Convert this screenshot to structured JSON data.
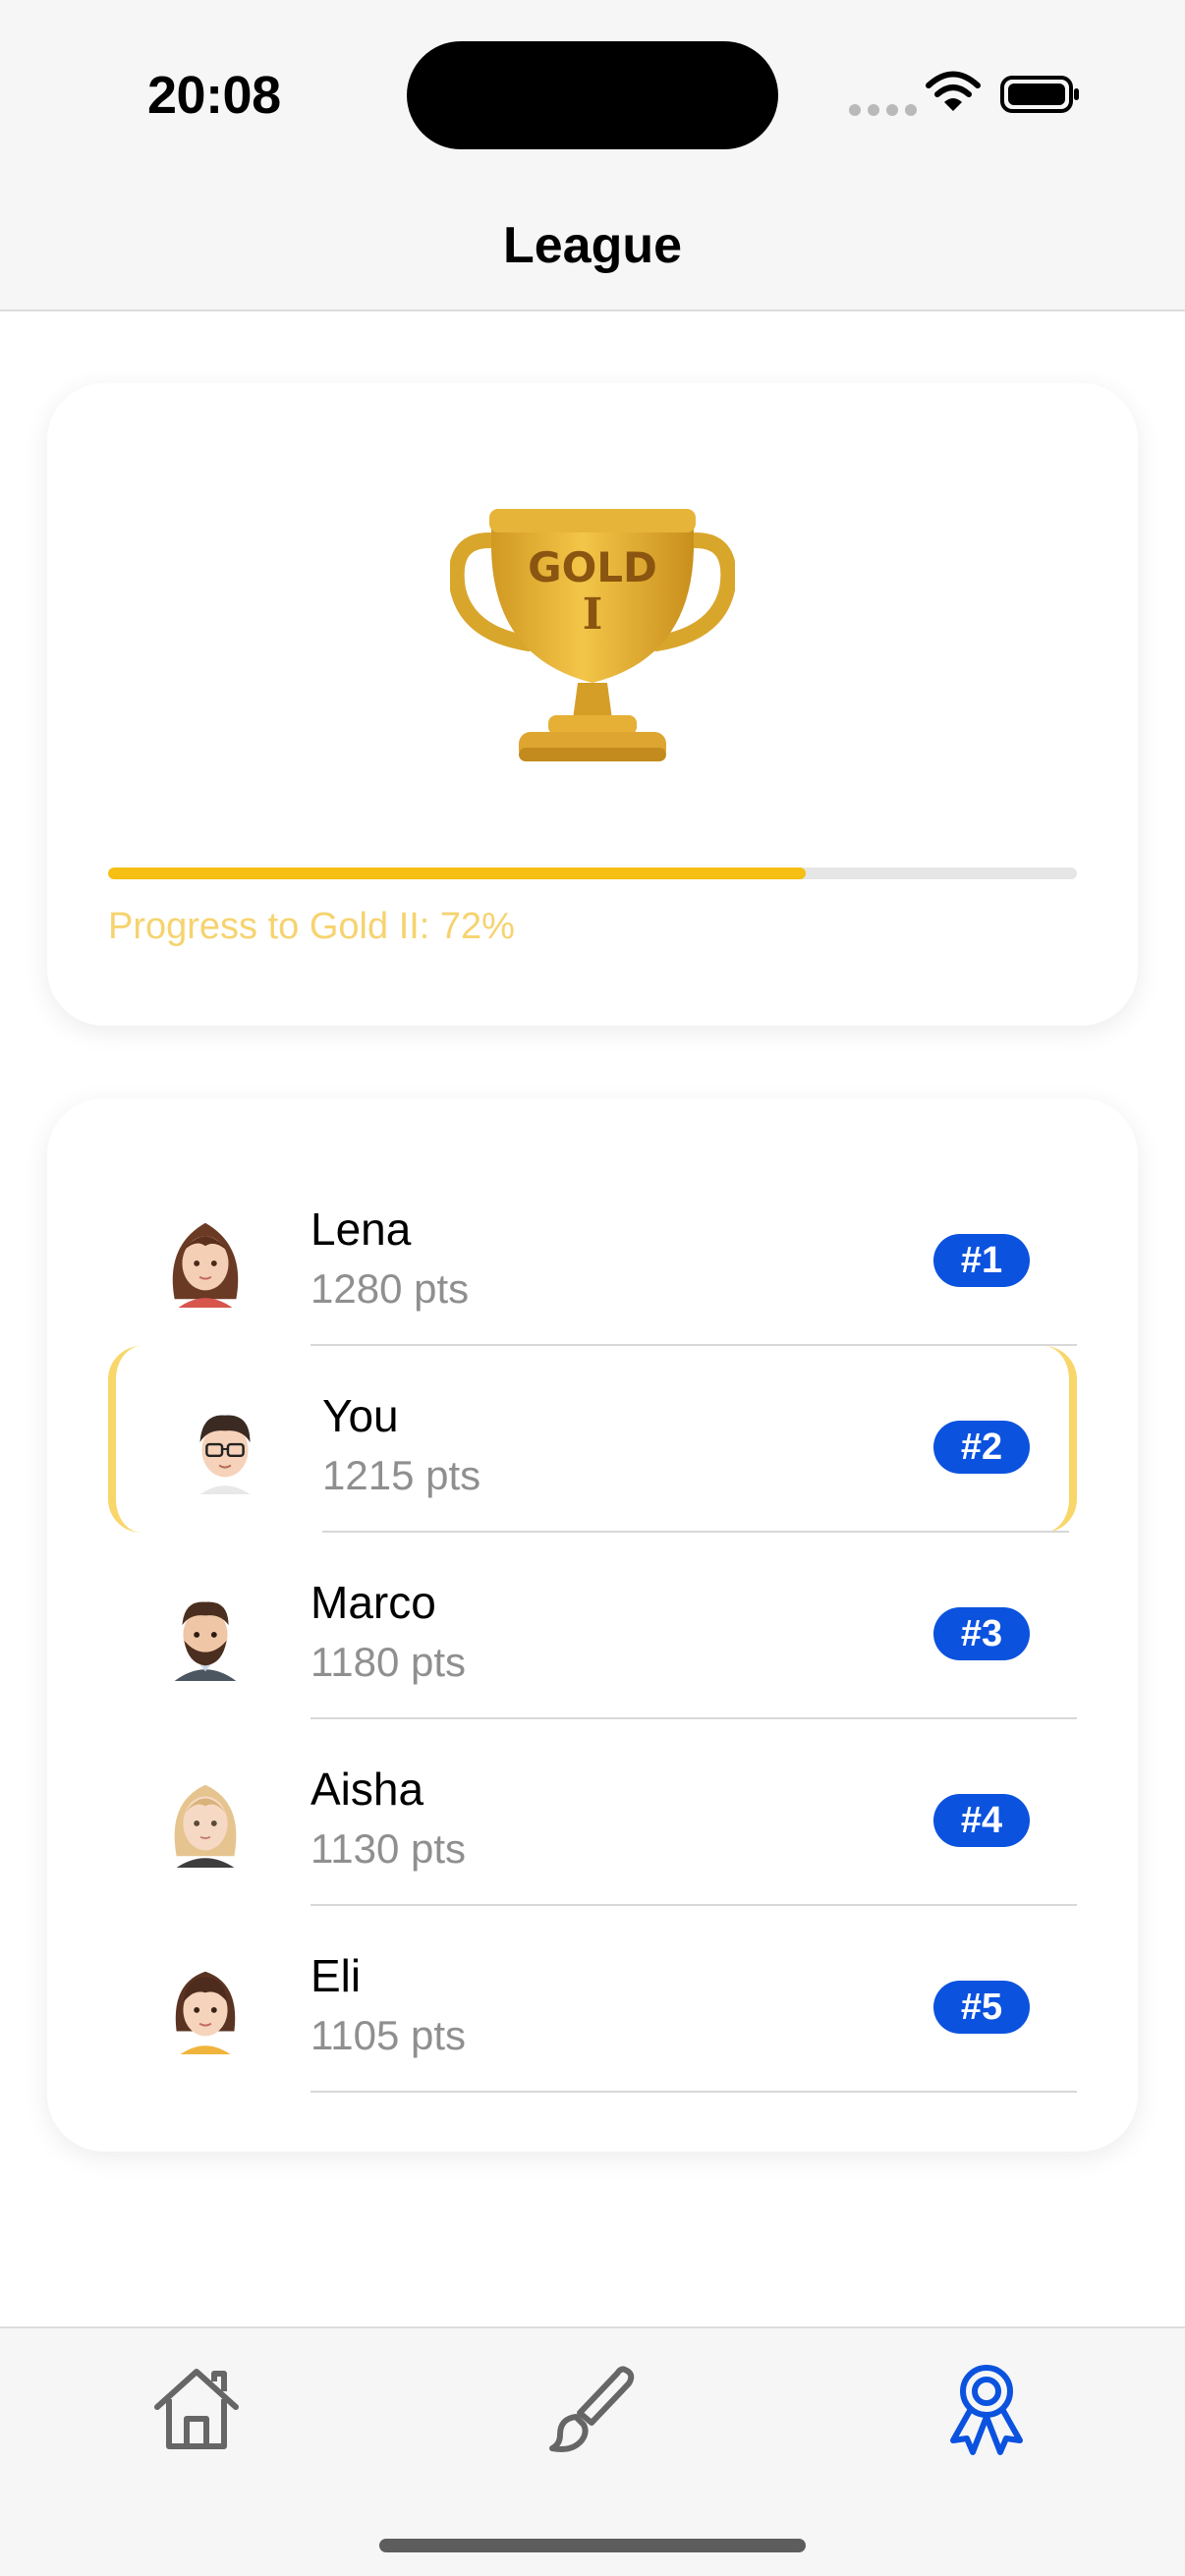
{
  "status_bar": {
    "time": "20:08"
  },
  "nav": {
    "title": "League"
  },
  "league": {
    "trophy_text_line1": "GOLD",
    "trophy_text_line2": "I",
    "progress_value": 0.72,
    "progress_label": "Progress to Gold II: 72%"
  },
  "leaderboard": [
    {
      "name": "Lena",
      "points": "1280 pts",
      "rank": "#1",
      "avatar": "woman-long-brown-hair-avatar"
    },
    {
      "name": "You",
      "points": "1215 pts",
      "rank": "#2",
      "avatar": "man-glasses-avatar"
    },
    {
      "name": "Marco",
      "points": "1180 pts",
      "rank": "#3",
      "avatar": "bearded-man-avatar"
    },
    {
      "name": "Aisha",
      "points": "1130 pts",
      "rank": "#4",
      "avatar": "blonde-woman-avatar"
    },
    {
      "name": "Eli",
      "points": "1105 pts",
      "rank": "#5",
      "avatar": "woman-short-brown-hair-avatar"
    }
  ],
  "tab_bar": [
    {
      "icon": "house-icon",
      "active": false
    },
    {
      "icon": "paintbrush-icon",
      "active": false
    },
    {
      "icon": "award-ribbon-icon",
      "active": true
    }
  ],
  "colors": {
    "accent": "#0b52df",
    "progress_fill": "#f5bf13",
    "progress_text": "#f6d36f",
    "highlight_border": "#f8d66a",
    "inactive_icon": "#666666"
  }
}
